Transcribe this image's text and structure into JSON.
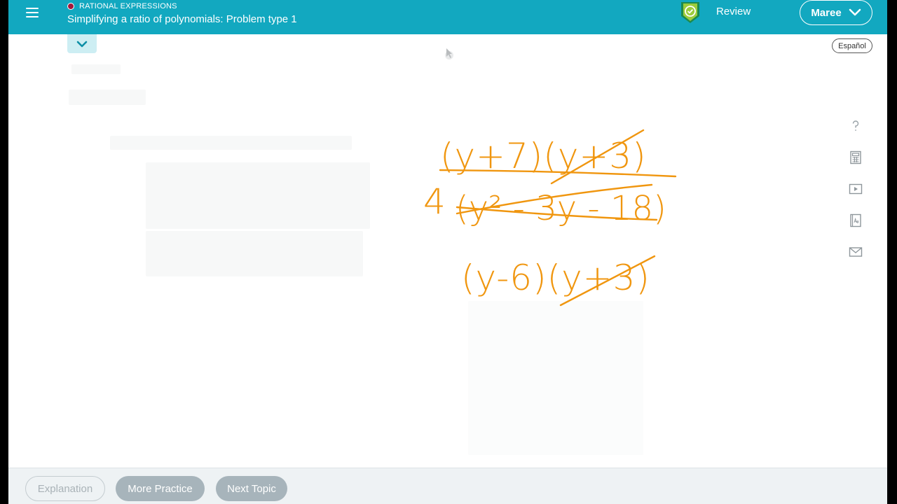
{
  "header": {
    "topic_label": "RATIONAL EXPRESSIONS",
    "title": "Simplifying a ratio of polynomials: Problem type 1",
    "review_label": "Review",
    "user_name": "Maree",
    "menu_icon": "hamburger-menu-icon",
    "review_icon": "shield-check-icon",
    "user_chevron_icon": "chevron-down-icon"
  },
  "language_button": "Español",
  "tools": [
    "help-icon",
    "calculator-icon",
    "video-icon",
    "dictionary-icon",
    "mail-icon"
  ],
  "whiteboard": {
    "ink_color": "#f0960f",
    "line1": "(y+7)(y+3)",
    "line2_prefix": "4",
    "line2": "(y² - 3y - 18)",
    "line3": "(y-6)(y+3)"
  },
  "footer": {
    "explanation": "Explanation",
    "more_practice": "More Practice",
    "next_topic": "Next Topic"
  },
  "colors": {
    "header_bg": "#12a8c0",
    "topic_dot": "#a3183c",
    "footer_bg": "#eef2f4",
    "footer_button": "#a7b4bb"
  }
}
